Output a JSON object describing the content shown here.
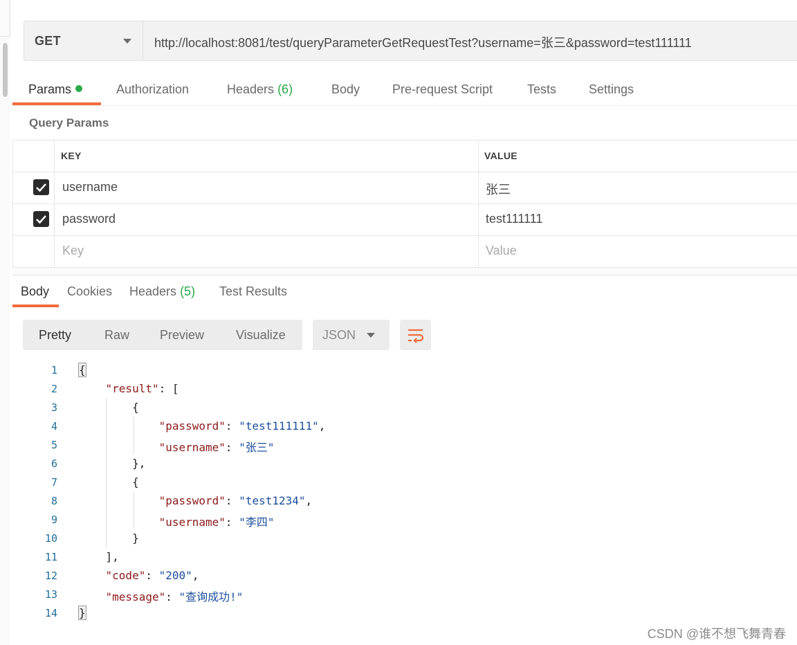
{
  "request": {
    "method": "GET",
    "url": "http://localhost:8081/test/queryParameterGetRequestTest?username=张三&password=test111111"
  },
  "request_tabs": {
    "params": "Params",
    "authorization": "Authorization",
    "headers": "Headers",
    "headers_count": "(6)",
    "body": "Body",
    "prerequest": "Pre-request Script",
    "tests": "Tests",
    "settings": "Settings"
  },
  "query_params": {
    "title": "Query Params",
    "col_key": "KEY",
    "col_value": "VALUE",
    "rows": [
      {
        "key": "username",
        "value": "张三",
        "checked": true
      },
      {
        "key": "password",
        "value": "test111111",
        "checked": true
      }
    ],
    "key_placeholder": "Key",
    "value_placeholder": "Value"
  },
  "response_tabs": {
    "body": "Body",
    "cookies": "Cookies",
    "headers": "Headers",
    "headers_count": "(5)",
    "test_results": "Test Results"
  },
  "view_modes": {
    "pretty": "Pretty",
    "raw": "Raw",
    "preview": "Preview",
    "visualize": "Visualize",
    "format": "JSON"
  },
  "response_body": {
    "line_numbers": [
      "1",
      "2",
      "3",
      "4",
      "5",
      "6",
      "7",
      "8",
      "9",
      "10",
      "11",
      "12",
      "13",
      "14"
    ],
    "result_key": "\"result\"",
    "password_key": "\"password\"",
    "username_key": "\"username\"",
    "code_key": "\"code\"",
    "message_key": "\"message\"",
    "result_0_password": "\"test111111\"",
    "result_0_username": "\"张三\"",
    "result_1_password": "\"test1234\"",
    "result_1_username": "\"李四\"",
    "code_value": "\"200\"",
    "message_value": "\"查询成功!\""
  },
  "colors": {
    "accent": "#f26b3a",
    "active_dot": "#2aa84a",
    "json_key": "#8b1a1a",
    "json_string": "#1c4e9c",
    "line_number": "#1f6e9a"
  },
  "watermark": "CSDN @谁不想飞舞青春"
}
